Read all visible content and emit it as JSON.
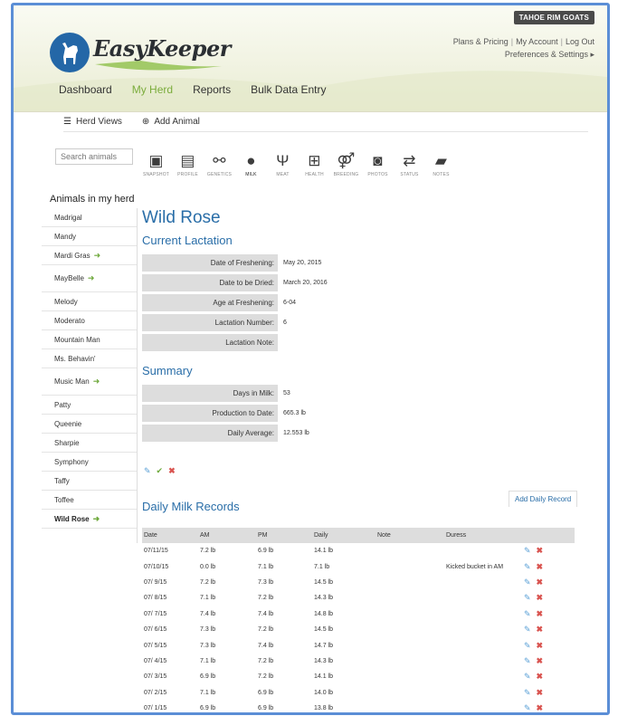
{
  "header": {
    "account_badge": "TAHOE RIM GOATS",
    "links": {
      "plans": "Plans & Pricing",
      "account": "My Account",
      "logout": "Log Out",
      "prefs": "Preferences & Settings"
    },
    "brand": "EasyKeeper",
    "colors": {
      "brand_blue": "#2467a7",
      "accent_green": "#7bac3c",
      "frame_blue": "#5b8ed6"
    }
  },
  "nav": {
    "dashboard": "Dashboard",
    "my_herd": "My Herd",
    "reports": "Reports",
    "bulk": "Bulk Data Entry"
  },
  "subnav": {
    "herd_views": "Herd Views",
    "add_animal": "Add Animal"
  },
  "search": {
    "placeholder": "Search animals"
  },
  "icons": [
    {
      "label": "SNAPSHOT",
      "icon": "snapshot-icon"
    },
    {
      "label": "PROFILE",
      "icon": "profile-icon"
    },
    {
      "label": "GENETICS",
      "icon": "genetics-icon"
    },
    {
      "label": "MILK",
      "icon": "milk-drop-icon"
    },
    {
      "label": "MEAT",
      "icon": "meat-icon"
    },
    {
      "label": "HEALTH",
      "icon": "health-icon"
    },
    {
      "label": "BREEDING",
      "icon": "breeding-icon"
    },
    {
      "label": "PHOTOS",
      "icon": "photos-icon"
    },
    {
      "label": "STATUS",
      "icon": "status-icon"
    },
    {
      "label": "NOTES",
      "icon": "notes-icon"
    }
  ],
  "sidebar": {
    "heading": "Animals in my herd",
    "animals": [
      "Madrigal",
      "Mandy",
      "Mardi Gras",
      "MayBelle",
      "Melody",
      "Moderato",
      "Mountain Man",
      "Ms. Behavin'",
      "Music Man",
      "Patty",
      "Queenie",
      "Sharpie",
      "Symphony",
      "Taffy",
      "Toffee",
      "Wild Rose"
    ]
  },
  "animal": {
    "name": "Wild Rose",
    "lactation": {
      "heading": "Current Lactation",
      "rows": [
        {
          "label": "Date of Freshening:",
          "value": "May 20, 2015"
        },
        {
          "label": "Date to be Dried:",
          "value": "March 20, 2016"
        },
        {
          "label": "Age at Freshening:",
          "value": "6-04"
        },
        {
          "label": "Lactation Number:",
          "value": "6"
        },
        {
          "label": "Lactation Note:",
          "value": ""
        }
      ]
    },
    "summary": {
      "heading": "Summary",
      "rows": [
        {
          "label": "Days in Milk:",
          "value": "53"
        },
        {
          "label": "Production to Date:",
          "value": "665.3 lb"
        },
        {
          "label": "Daily Average:",
          "value": "12.553 lb"
        }
      ]
    }
  },
  "records": {
    "heading": "Daily Milk Records",
    "add_button": "Add Daily Record",
    "columns": [
      "Date",
      "AM",
      "PM",
      "Daily",
      "Note",
      "Duress"
    ],
    "rows": [
      [
        "07/11/15",
        "7.2 lb",
        "6.9 lb",
        "14.1 lb",
        "",
        ""
      ],
      [
        "07/10/15",
        "0.0 lb",
        "7.1 lb",
        "7.1 lb",
        "",
        "Kicked bucket in AM"
      ],
      [
        "07/ 9/15",
        "7.2 lb",
        "7.3 lb",
        "14.5 lb",
        "",
        ""
      ],
      [
        "07/ 8/15",
        "7.1 lb",
        "7.2 lb",
        "14.3 lb",
        "",
        ""
      ],
      [
        "07/ 7/15",
        "7.4 lb",
        "7.4 lb",
        "14.8 lb",
        "",
        ""
      ],
      [
        "07/ 6/15",
        "7.3 lb",
        "7.2 lb",
        "14.5 lb",
        "",
        ""
      ],
      [
        "07/ 5/15",
        "7.3 lb",
        "7.4 lb",
        "14.7 lb",
        "",
        ""
      ],
      [
        "07/ 4/15",
        "7.1 lb",
        "7.2 lb",
        "14.3 lb",
        "",
        ""
      ],
      [
        "07/ 3/15",
        "6.9 lb",
        "7.2 lb",
        "14.1 lb",
        "",
        ""
      ],
      [
        "07/ 2/15",
        "7.1 lb",
        "6.9 lb",
        "14.0 lb",
        "",
        ""
      ],
      [
        "07/ 1/15",
        "6.9 lb",
        "6.9 lb",
        "13.8 lb",
        "",
        ""
      ]
    ]
  }
}
